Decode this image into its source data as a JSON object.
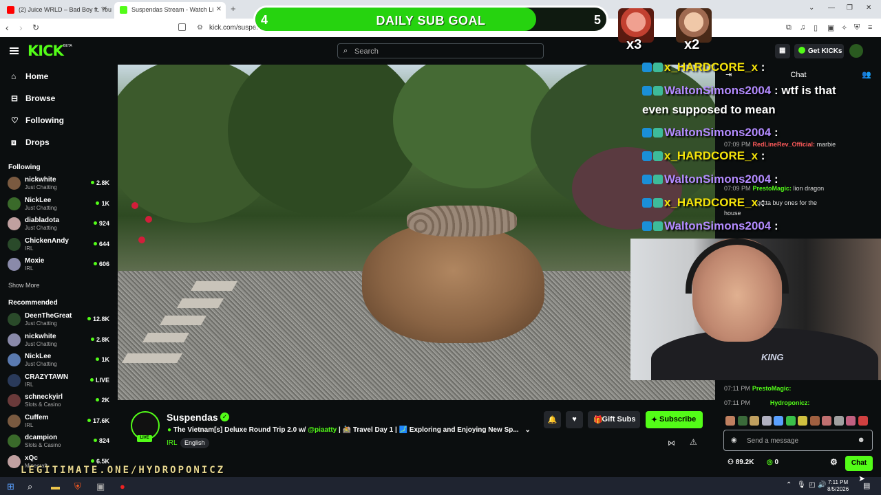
{
  "browser": {
    "tabs": [
      {
        "title": "(2) Juice WRLD – Bad Boy ft. Young T",
        "favicon_color": "#ff0000"
      },
      {
        "title": "Suspendas Stream - Watch Li",
        "favicon_color": "#53fc18"
      }
    ],
    "new_tab": "+",
    "url": "kick.com/susper"
  },
  "overlay_goal": {
    "current": "4",
    "label": "DAILY SUB GOAL",
    "target": "5",
    "progress": 0.8,
    "multipliers": [
      "x3",
      "x2"
    ]
  },
  "kick": {
    "logo": "KICK",
    "beta": "BETA",
    "search_placeholder": "Search",
    "get_kicks": "Get KICKs"
  },
  "sidebar": {
    "nav": [
      {
        "label": "Home",
        "icon": "home-icon"
      },
      {
        "label": "Browse",
        "icon": "browse-icon"
      },
      {
        "label": "Following",
        "icon": "heart-icon"
      },
      {
        "label": "Drops",
        "icon": "drops-icon"
      }
    ],
    "following_title": "Following",
    "following": [
      {
        "name": "nickwhite",
        "category": "Just Chatting",
        "viewers": "2.8K"
      },
      {
        "name": "NickLee",
        "category": "Just Chatting",
        "viewers": "1K"
      },
      {
        "name": "diabladota",
        "category": "Just Chatting",
        "viewers": "924"
      },
      {
        "name": "ChickenAndy",
        "category": "IRL",
        "viewers": "644"
      },
      {
        "name": "Moxie",
        "category": "IRL",
        "viewers": "606"
      }
    ],
    "show_more": "Show More",
    "recommended_title": "Recommended",
    "recommended": [
      {
        "name": "DeenTheGreat",
        "category": "Just Chatting",
        "viewers": "12.8K"
      },
      {
        "name": "nickwhite",
        "category": "Just Chatting",
        "viewers": "2.8K"
      },
      {
        "name": "NickLee",
        "category": "Just Chatting",
        "viewers": "1K"
      },
      {
        "name": "CRAZYTAWN",
        "category": "IRL",
        "viewers": "LIVE"
      },
      {
        "name": "schneckyirl",
        "category": "Slots & Casino",
        "viewers": "2K"
      },
      {
        "name": "Cuffem",
        "category": "IRL",
        "viewers": "17.6K"
      },
      {
        "name": "dcampion",
        "category": "Slots & Casino",
        "viewers": "824"
      },
      {
        "name": "xQc",
        "category": "Minecraft",
        "viewers": "6.5K"
      }
    ]
  },
  "chat_overlay": [
    {
      "user": "x_HARDCORE_x",
      "msg": " :",
      "color": "#f5e30a"
    },
    {
      "user": "WaltonSimons2004",
      "msg": " : wtf is that",
      "color": "#b38bff"
    },
    {
      "user": "",
      "msg": "even supposed to mean",
      "color": "#fff"
    },
    {
      "user": "WaltonSimons2004",
      "msg": " :",
      "color": "#b38bff"
    },
    {
      "user": "x_HARDCORE_x",
      "msg": " :",
      "color": "#f5e30a"
    },
    {
      "user": "WaltonSimons2004",
      "msg": " :",
      "color": "#b38bff"
    },
    {
      "user": "x_HARDCORE_x",
      "msg": " :",
      "color": "#f5e30a"
    },
    {
      "user": "WaltonSimons2004",
      "msg": " :",
      "color": "#b38bff"
    }
  ],
  "kick_chat": {
    "header": "Chat",
    "messages": [
      {
        "time": "07:09 PM",
        "user": "RedLineRev_Official:",
        "msg": "marbie",
        "color": "#ff5a5a"
      },
      {
        "time": "07:09 PM",
        "user": "PrestoMagic:",
        "msg": "lion dragon",
        "color": "#53fc18"
      },
      {
        "time": "",
        "user": "",
        "msg": "gotta buy ones for the",
        "color": "#ddd"
      },
      {
        "time": "",
        "user": "",
        "msg": "house",
        "color": "#ddd"
      },
      {
        "time": "07:11 PM",
        "user": "PrestoMagic:",
        "msg": "",
        "color": "#53fc18"
      },
      {
        "time": "07:11 PM",
        "user": "Hydroponicz:",
        "msg": "",
        "color": "#53fc18"
      }
    ],
    "send_placeholder": "Send a message",
    "viewers": "89.2K",
    "kicks": "0",
    "chat_button": "Chat"
  },
  "stream": {
    "name": "Suspendas",
    "live": "LIVE",
    "title_pre": "The Vietnam[ѕ] Deluxe Round Trip 2.0 w/ ",
    "mention": "@piaatty",
    "title_post": " | 🚵 Travel Day 1 | 🗾 Exploring and Enjoying New Sp...",
    "category": "IRL",
    "language": "English",
    "gift_subs": "Gift Subs",
    "subscribe": "Subscribe"
  },
  "overlay_banner": "LEGITIMATE.ONE/HYDROPONICZ",
  "taskbar": {
    "time": "7:11 PM",
    "date": "8/5/2026"
  }
}
